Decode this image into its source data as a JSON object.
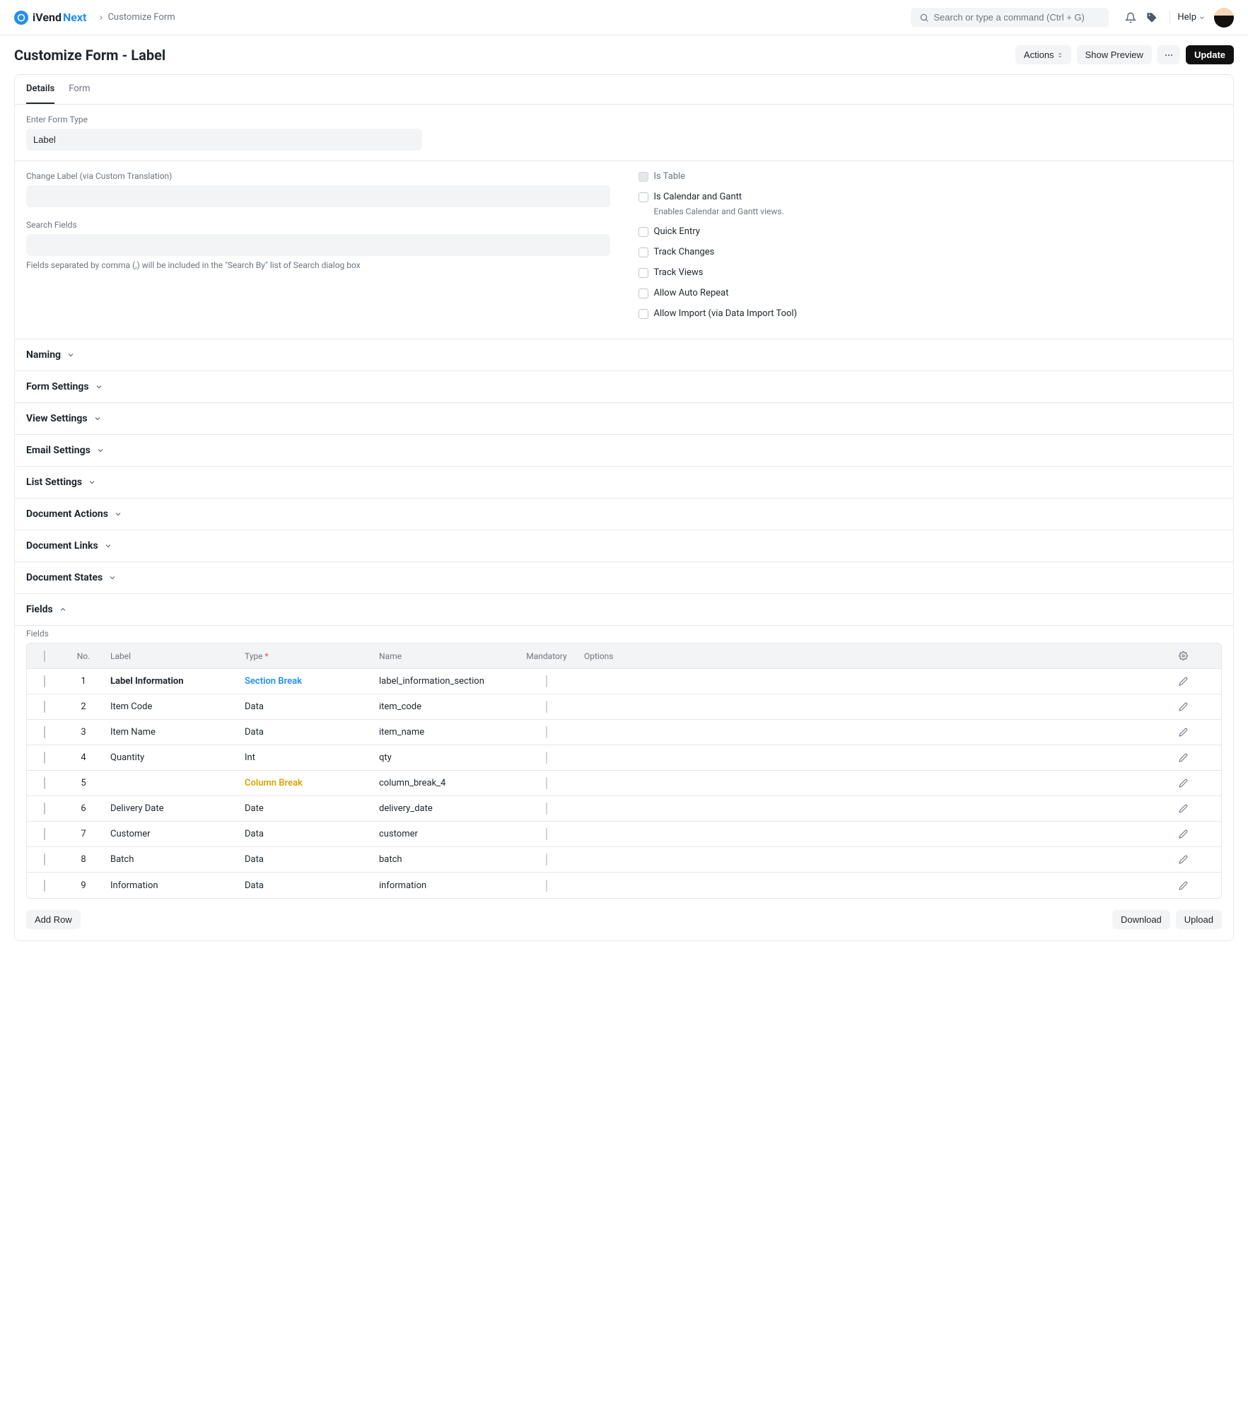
{
  "nav": {
    "logo_vend": "iVend",
    "logo_next": "Next",
    "breadcrumb": "Customize Form",
    "search_placeholder": "Search or type a command (Ctrl + G)",
    "help": "Help"
  },
  "page": {
    "title": "Customize Form - Label",
    "actions_btn": "Actions",
    "show_preview_btn": "Show Preview",
    "update_btn": "Update"
  },
  "tabs": {
    "details": "Details",
    "form": "Form"
  },
  "details": {
    "enter_form_type_label": "Enter Form Type",
    "enter_form_type_value": "Label",
    "change_label_label": "Change Label (via Custom Translation)",
    "search_fields_label": "Search Fields",
    "search_fields_help": "Fields separated by comma (,) will be included in the \"Search By\" list of Search dialog box",
    "cb_is_table": "Is Table",
    "cb_is_calendar": "Is Calendar and Gantt",
    "cb_is_calendar_help": "Enables Calendar and Gantt views.",
    "cb_quick_entry": "Quick Entry",
    "cb_track_changes": "Track Changes",
    "cb_track_views": "Track Views",
    "cb_auto_repeat": "Allow Auto Repeat",
    "cb_allow_import": "Allow Import (via Data Import Tool)"
  },
  "collapsibles": [
    "Naming",
    "Form Settings",
    "View Settings",
    "Email Settings",
    "List Settings",
    "Document Actions",
    "Document Links",
    "Document States"
  ],
  "fields_section": {
    "title": "Fields",
    "subtitle": "Fields",
    "headers": {
      "no": "No.",
      "label": "Label",
      "type": "Type",
      "name": "Name",
      "mandatory": "Mandatory",
      "options": "Options"
    },
    "rows": [
      {
        "no": "1",
        "label": "Label Information",
        "type": "Section Break",
        "type_class": "type-link",
        "name": "label_information_section",
        "bold": true
      },
      {
        "no": "2",
        "label": "Item Code",
        "type": "Data",
        "type_class": "",
        "name": "item_code"
      },
      {
        "no": "3",
        "label": "Item Name",
        "type": "Data",
        "type_class": "",
        "name": "item_name"
      },
      {
        "no": "4",
        "label": "Quantity",
        "type": "Int",
        "type_class": "",
        "name": "qty"
      },
      {
        "no": "5",
        "label": "",
        "type": "Column Break",
        "type_class": "type-colbreak",
        "name": "column_break_4"
      },
      {
        "no": "6",
        "label": "Delivery Date",
        "type": "Date",
        "type_class": "",
        "name": "delivery_date"
      },
      {
        "no": "7",
        "label": "Customer",
        "type": "Data",
        "type_class": "",
        "name": "customer"
      },
      {
        "no": "8",
        "label": "Batch",
        "type": "Data",
        "type_class": "",
        "name": "batch"
      },
      {
        "no": "9",
        "label": "Information",
        "type": "Data",
        "type_class": "",
        "name": "information"
      }
    ],
    "add_row": "Add Row",
    "download": "Download",
    "upload": "Upload"
  }
}
